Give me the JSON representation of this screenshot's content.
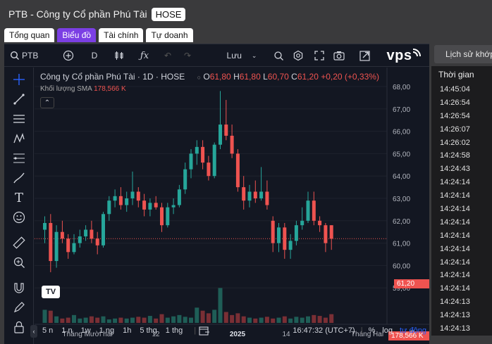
{
  "title": "PTB - Công ty Cổ phần Phú Tài",
  "exchange_badge": "HOSE",
  "tabs": [
    {
      "label": "Tổng quan",
      "active": false
    },
    {
      "label": "Biểu đồ",
      "active": true
    },
    {
      "label": "Tài chính",
      "active": false
    },
    {
      "label": "Tự doanh",
      "active": false
    }
  ],
  "toolbar": {
    "symbol": "PTB",
    "interval": "D",
    "save_label": "Lưu",
    "brand": "vps"
  },
  "legend": {
    "name": "Công ty Cổ phần Phú Tài · 1D · HOSE",
    "o_label": "O",
    "o": "61,80",
    "h_label": "H",
    "h": "61,80",
    "l_label": "L",
    "l": "60,70",
    "c_label": "C",
    "c": "61,20",
    "change": "+0,20 (+0,33%)"
  },
  "volume_legend": {
    "label": "Khối lượng",
    "ma": "SMA",
    "value": "178,566 K"
  },
  "price_axis": [
    "68,00",
    "67,00",
    "66,00",
    "65,00",
    "64,00",
    "63,00",
    "62,00",
    "61,00",
    "60,00",
    "59,00"
  ],
  "current_price_tag": "61,20",
  "volume_tag": "178,566 K",
  "time_axis": [
    "Tháng Mười hai",
    "12",
    "2025",
    "14",
    "Tháng Hai"
  ],
  "bottom": {
    "ranges": [
      "5 n",
      "1 n",
      "1w",
      "1 ng",
      "1h",
      "5 thg",
      "1 thg"
    ],
    "clock": "16:47:32 (UTC+7)",
    "percent": "%",
    "log": "log",
    "auto": "tự động"
  },
  "right_panel": {
    "history_button": "Lịch sử khớp",
    "header": "Thời gian",
    "times": [
      "14:45:04",
      "14:26:54",
      "14:26:54",
      "14:26:07",
      "14:26:02",
      "14:24:58",
      "14:24:43",
      "14:24:14",
      "14:24:14",
      "14:24:14",
      "14:24:14",
      "14:24:14",
      "14:24:14",
      "14:24:14",
      "14:24:14",
      "14:24:14",
      "14:24:13",
      "14:24:13",
      "14:24:13"
    ]
  },
  "colors": {
    "up": "#26a69a",
    "down": "#ef5350",
    "bg": "#131722",
    "accent": "#7b3fe4"
  },
  "chart_data": {
    "type": "candlestick",
    "ylim": [
      58.5,
      68.2
    ],
    "candles": [
      {
        "o": 61.6,
        "h": 62.2,
        "l": 61.0,
        "c": 61.9
      },
      {
        "o": 61.9,
        "h": 62.3,
        "l": 59.7,
        "c": 60.2
      },
      {
        "o": 60.2,
        "h": 61.8,
        "l": 59.9,
        "c": 61.5
      },
      {
        "o": 61.5,
        "h": 62.0,
        "l": 61.0,
        "c": 61.2
      },
      {
        "o": 61.2,
        "h": 61.4,
        "l": 60.3,
        "c": 60.6
      },
      {
        "o": 60.6,
        "h": 61.4,
        "l": 60.5,
        "c": 61.0
      },
      {
        "o": 61.0,
        "h": 61.6,
        "l": 60.8,
        "c": 61.3
      },
      {
        "o": 61.3,
        "h": 61.8,
        "l": 61.1,
        "c": 61.6
      },
      {
        "o": 61.6,
        "h": 62.0,
        "l": 61.0,
        "c": 61.2
      },
      {
        "o": 61.2,
        "h": 61.5,
        "l": 60.5,
        "c": 60.9
      },
      {
        "o": 60.9,
        "h": 62.4,
        "l": 60.8,
        "c": 62.3
      },
      {
        "o": 62.3,
        "h": 63.1,
        "l": 62.0,
        "c": 62.9
      },
      {
        "o": 62.9,
        "h": 63.4,
        "l": 62.6,
        "c": 63.1
      },
      {
        "o": 63.1,
        "h": 63.5,
        "l": 62.5,
        "c": 62.7
      },
      {
        "o": 62.7,
        "h": 63.3,
        "l": 62.4,
        "c": 63.0
      },
      {
        "o": 63.0,
        "h": 64.2,
        "l": 62.7,
        "c": 63.3
      },
      {
        "o": 63.3,
        "h": 63.5,
        "l": 62.6,
        "c": 62.9
      },
      {
        "o": 62.9,
        "h": 63.2,
        "l": 62.2,
        "c": 62.5
      },
      {
        "o": 62.5,
        "h": 63.0,
        "l": 62.2,
        "c": 62.8
      },
      {
        "o": 62.8,
        "h": 63.1,
        "l": 62.5,
        "c": 62.6
      },
      {
        "o": 62.6,
        "h": 62.8,
        "l": 61.5,
        "c": 61.8
      },
      {
        "o": 61.8,
        "h": 62.8,
        "l": 61.7,
        "c": 62.6
      },
      {
        "o": 62.6,
        "h": 63.0,
        "l": 62.3,
        "c": 62.7
      },
      {
        "o": 62.7,
        "h": 63.6,
        "l": 62.6,
        "c": 63.4
      },
      {
        "o": 63.4,
        "h": 64.6,
        "l": 63.2,
        "c": 64.3
      },
      {
        "o": 64.3,
        "h": 65.2,
        "l": 63.9,
        "c": 65.0
      },
      {
        "o": 65.0,
        "h": 65.6,
        "l": 64.5,
        "c": 65.3
      },
      {
        "o": 65.3,
        "h": 65.6,
        "l": 64.3,
        "c": 64.6
      },
      {
        "o": 64.6,
        "h": 64.9,
        "l": 63.8,
        "c": 64.0
      },
      {
        "o": 64.0,
        "h": 65.5,
        "l": 63.9,
        "c": 65.4
      },
      {
        "o": 65.4,
        "h": 67.8,
        "l": 65.2,
        "c": 66.3
      },
      {
        "o": 66.3,
        "h": 67.4,
        "l": 65.6,
        "c": 65.8
      },
      {
        "o": 65.8,
        "h": 66.3,
        "l": 64.8,
        "c": 65.0
      },
      {
        "o": 65.0,
        "h": 65.2,
        "l": 63.3,
        "c": 63.5
      },
      {
        "o": 63.5,
        "h": 64.0,
        "l": 62.5,
        "c": 62.9
      },
      {
        "o": 62.9,
        "h": 63.6,
        "l": 62.6,
        "c": 63.3
      },
      {
        "o": 63.3,
        "h": 63.8,
        "l": 62.8,
        "c": 63.0
      },
      {
        "o": 63.0,
        "h": 64.4,
        "l": 62.9,
        "c": 63.3
      },
      {
        "o": 63.3,
        "h": 63.8,
        "l": 62.5,
        "c": 62.7
      },
      {
        "o": 62.0,
        "h": 62.2,
        "l": 60.6,
        "c": 61.0
      },
      {
        "o": 61.0,
        "h": 61.9,
        "l": 60.6,
        "c": 61.7
      },
      {
        "o": 61.7,
        "h": 61.9,
        "l": 60.3,
        "c": 60.7
      },
      {
        "o": 60.7,
        "h": 61.4,
        "l": 60.3,
        "c": 61.1
      },
      {
        "o": 61.1,
        "h": 62.0,
        "l": 60.9,
        "c": 61.8
      },
      {
        "o": 61.8,
        "h": 62.6,
        "l": 61.6,
        "c": 62.0
      },
      {
        "o": 62.0,
        "h": 63.3,
        "l": 61.9,
        "c": 62.9
      },
      {
        "o": 62.9,
        "h": 63.3,
        "l": 61.8,
        "c": 62.0
      },
      {
        "o": 62.0,
        "h": 62.2,
        "l": 61.5,
        "c": 61.8
      },
      {
        "o": 61.8,
        "h": 61.9,
        "l": 60.6,
        "c": 61.0
      },
      {
        "o": 61.8,
        "h": 61.8,
        "l": 60.7,
        "c": 61.2
      }
    ],
    "volumes": [
      0.3,
      0.28,
      0.15,
      0.1,
      0.12,
      0.18,
      0.1,
      0.12,
      0.15,
      0.12,
      0.15,
      0.08,
      0.1,
      0.12,
      0.1,
      0.12,
      0.14,
      0.12,
      0.16,
      0.1,
      0.2,
      0.12,
      0.15,
      0.18,
      0.14,
      0.12,
      0.35,
      0.28,
      0.22,
      0.3,
      0.8,
      0.25,
      0.18,
      0.22,
      0.15,
      0.12,
      0.1,
      0.12,
      0.14,
      0.1,
      0.12,
      0.15,
      0.1,
      0.14,
      0.12,
      0.15,
      0.18,
      0.16,
      0.12,
      0.2
    ]
  }
}
